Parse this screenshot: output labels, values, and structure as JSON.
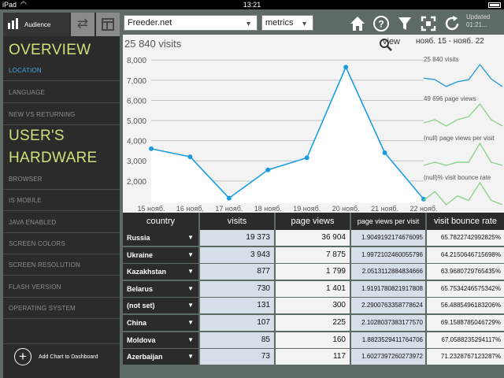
{
  "status_bar": {
    "device": "iPad",
    "time": "13:21"
  },
  "sidebar": {
    "tab_label": "Audience",
    "overview_title": "OVERVIEW",
    "overview_items": [
      "LOCATION",
      "LANGUAGE",
      "NEW VS RETURNING"
    ],
    "hardware_title_line1": "USER'S",
    "hardware_title_line2": "HARDWARE",
    "hardware_items": [
      "BROWSER",
      "IS MOBILE",
      "JAVA ENABLED",
      "SCREEN COLORS",
      "SCREEN RESOLUTION",
      "FLASH VERSION",
      "OPERATING SYSTEM"
    ],
    "add_chart_label": "Add Chart to Dashboard"
  },
  "topbar": {
    "site_select": "Freeder.net",
    "metrics_select": "metrics",
    "updated_label": "Updated",
    "updated_time": "01:21..."
  },
  "chart_header": {
    "visits_title": "25 840 visits",
    "view_label": "view",
    "view_range": "нояб. 15 - нояб. 22"
  },
  "chart_data": {
    "type": "line",
    "categories": [
      "15 нояб.",
      "16 нояб.",
      "17 нояб.",
      "18 нояб.",
      "19 нояб.",
      "20 нояб.",
      "21 нояб.",
      "22 нояб."
    ],
    "values": [
      3600,
      3200,
      1150,
      2550,
      3150,
      7650,
      3400,
      1100
    ],
    "yticks": [
      2000,
      3000,
      4000,
      5000,
      6000,
      7000,
      8000
    ],
    "ytick_labels": [
      "2,000",
      "3,000",
      "4,000",
      "5,000",
      "6,000",
      "7,000",
      "8,000"
    ],
    "ylim": [
      900,
      8400
    ],
    "xlabel": "",
    "ylabel": "",
    "grid": true,
    "colors": {
      "line": "#1a9de0",
      "fill": "#ffffff",
      "spark_blue": "#2a9bd6",
      "spark_green": "#8fd48c"
    }
  },
  "sparklines": [
    {
      "label": "25 840 visits",
      "color": "#2a9bd6",
      "values": [
        3600,
        3200,
        1150,
        2550,
        3150,
        7650,
        3400,
        1100
      ]
    },
    {
      "label": "49 696 page views",
      "color": "#8fd48c",
      "values": [
        3,
        4,
        2,
        4,
        5,
        9,
        4,
        2
      ]
    },
    {
      "label": "(null) page views per visit",
      "color": "#8fd48c",
      "values": [
        2,
        3,
        2,
        3,
        3,
        9,
        3,
        2
      ]
    },
    {
      "label": "(null)% visit bounce rate",
      "color": "#8fd48c",
      "values": [
        4,
        6,
        3,
        5,
        4,
        8,
        4,
        3
      ]
    }
  ],
  "table": {
    "headers": [
      "country",
      "visits",
      "page views",
      "page views per visit",
      "visit bounce rate"
    ],
    "rows": [
      {
        "country": "Russia",
        "visits": "19 373",
        "page_views": "36 904",
        "pvpv": "1.9049192174676095",
        "bounce": "65.7822742992825%"
      },
      {
        "country": "Ukraine",
        "visits": "3 943",
        "page_views": "7 875",
        "pvpv": "1.9972102460055796",
        "bounce": "64.2150646715698%"
      },
      {
        "country": "Kazakhstan",
        "visits": "877",
        "page_views": "1 799",
        "pvpv": "2.0513112884834666",
        "bounce": "63.9680729765435%"
      },
      {
        "country": "Belarus",
        "visits": "730",
        "page_views": "1 401",
        "pvpv": "1.9191780821917808",
        "bounce": "65.7534246575342%"
      },
      {
        "country": "(not set)",
        "visits": "131",
        "page_views": "300",
        "pvpv": "2.2900763358778624",
        "bounce": "56.4885496183206%"
      },
      {
        "country": "China",
        "visits": "107",
        "page_views": "225",
        "pvpv": "2.1028037383177570",
        "bounce": "69.1588785046729%"
      },
      {
        "country": "Moldova",
        "visits": "85",
        "page_views": "160",
        "pvpv": "1.8823529411764706",
        "bounce": "67.0588235294117%"
      },
      {
        "country": "Azerbaijan",
        "visits": "73",
        "page_views": "117",
        "pvpv": "1.6027397260273972",
        "bounce": "71.2328767123287%"
      }
    ]
  }
}
